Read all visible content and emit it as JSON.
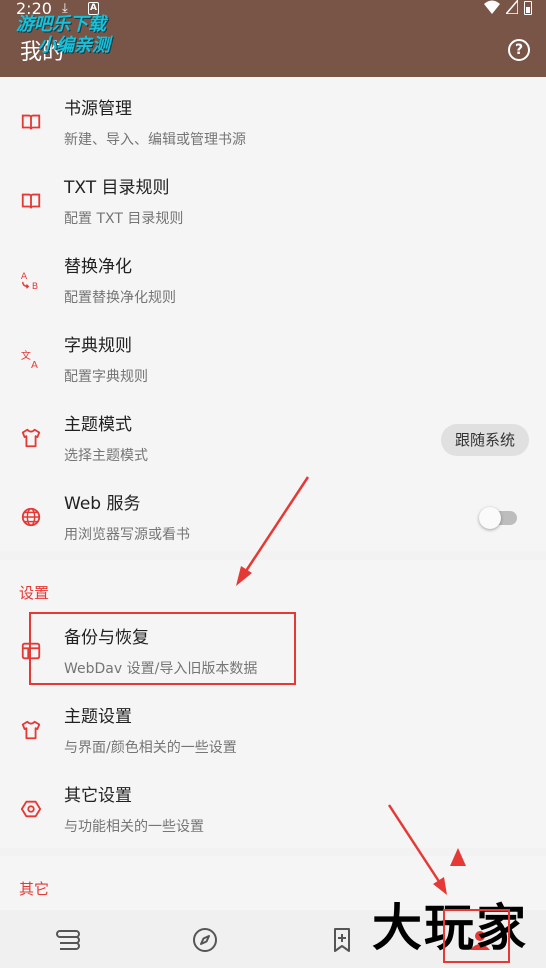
{
  "status_bar": {
    "time": "2:20",
    "download_glyph": "⤓",
    "notif_letter": "A",
    "wifi_glyph": "▼"
  },
  "app_bar": {
    "title": "我的",
    "help_glyph": "?"
  },
  "watermark": {
    "line1": "游吧乐下载",
    "line2": "小编亲测"
  },
  "items": [
    {
      "title": "书源管理",
      "sub": "新建、导入、编辑或管理书源",
      "icon": "book-open-icon"
    },
    {
      "title": "TXT 目录规则",
      "sub": "配置 TXT 目录规则",
      "icon": "book-open-icon"
    },
    {
      "title": "替换净化",
      "sub": "配置替换净化规则",
      "icon": "replace-ab-icon"
    },
    {
      "title": "字典规则",
      "sub": "配置字典规则",
      "icon": "translate-icon"
    },
    {
      "title": "主题模式",
      "sub": "选择主题模式",
      "icon": "tshirt-icon",
      "chip": "跟随系统"
    },
    {
      "title": "Web 服务",
      "sub": "用浏览器写源或看书",
      "icon": "globe-icon",
      "toggle_on": false
    }
  ],
  "settings": {
    "label": "设置",
    "items": [
      {
        "title": "备份与恢复",
        "sub": "WebDav 设置/导入旧版本数据",
        "icon": "backup-icon"
      },
      {
        "title": "主题设置",
        "sub": "与界面/颜色相关的一些设置",
        "icon": "tshirt-icon"
      },
      {
        "title": "其它设置",
        "sub": "与功能相关的一些设置",
        "icon": "hexagon-gear-icon"
      }
    ]
  },
  "other": {
    "label": "其它"
  },
  "bottom_nav": [
    {
      "name": "bookshelf",
      "icon": "bookshelf-icon"
    },
    {
      "name": "discover",
      "icon": "compass-icon"
    },
    {
      "name": "rss",
      "icon": "bookmark-plus-icon"
    },
    {
      "name": "my",
      "icon": "person-icon",
      "selected": true
    }
  ],
  "stamp_text": "大玩家",
  "colors": {
    "app_bar": "#795548",
    "accent": "#e53935",
    "background": "#f5f5f5",
    "annotation": "#e53935"
  }
}
